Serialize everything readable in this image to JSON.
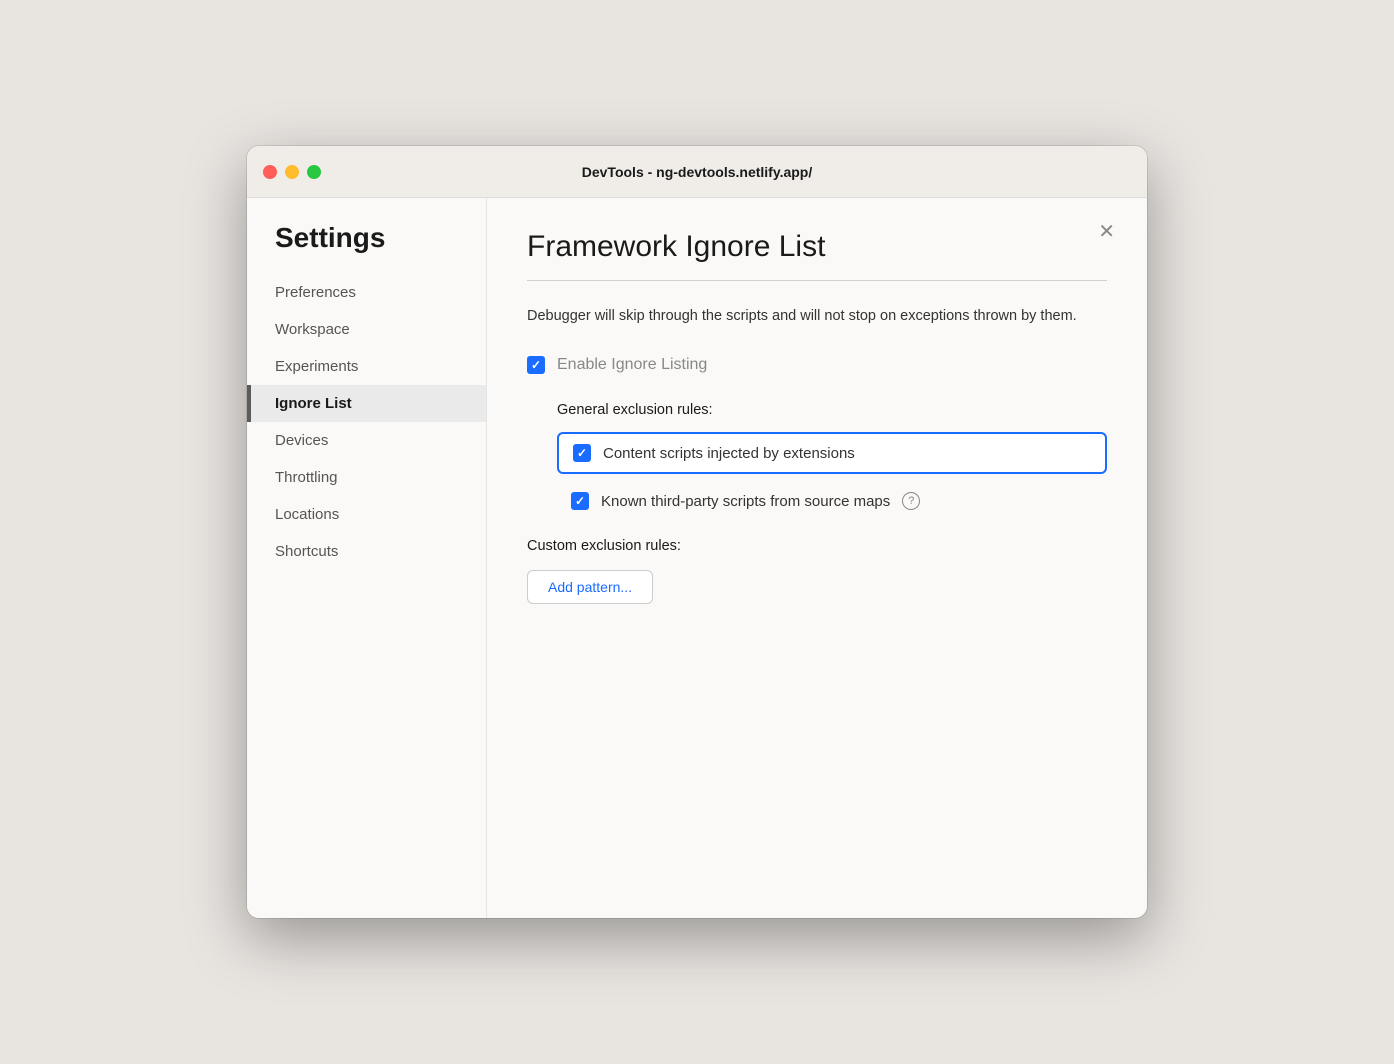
{
  "window": {
    "title": "DevTools - ng-devtools.netlify.app/"
  },
  "sidebar": {
    "heading": "Settings",
    "items": [
      {
        "id": "preferences",
        "label": "Preferences",
        "active": false
      },
      {
        "id": "workspace",
        "label": "Workspace",
        "active": false
      },
      {
        "id": "experiments",
        "label": "Experiments",
        "active": false
      },
      {
        "id": "ignore-list",
        "label": "Ignore List",
        "active": true
      },
      {
        "id": "devices",
        "label": "Devices",
        "active": false
      },
      {
        "id": "throttling",
        "label": "Throttling",
        "active": false
      },
      {
        "id": "locations",
        "label": "Locations",
        "active": false
      },
      {
        "id": "shortcuts",
        "label": "Shortcuts",
        "active": false
      }
    ]
  },
  "main": {
    "title": "Framework Ignore List",
    "description": "Debugger will skip through the scripts and will not stop on exceptions thrown by them.",
    "enable_label": "Enable Ignore Listing",
    "enable_checked": true,
    "general_section_label": "General exclusion rules:",
    "rules": [
      {
        "id": "content-scripts",
        "label": "Content scripts injected by extensions",
        "checked": true,
        "highlighted": true,
        "help": false
      },
      {
        "id": "third-party-scripts",
        "label": "Known third-party scripts from source maps",
        "checked": true,
        "highlighted": false,
        "help": true
      }
    ],
    "custom_section_label": "Custom exclusion rules:",
    "add_pattern_label": "Add pattern..."
  },
  "icons": {
    "close": "✕",
    "checkmark": "✓",
    "help": "?"
  }
}
